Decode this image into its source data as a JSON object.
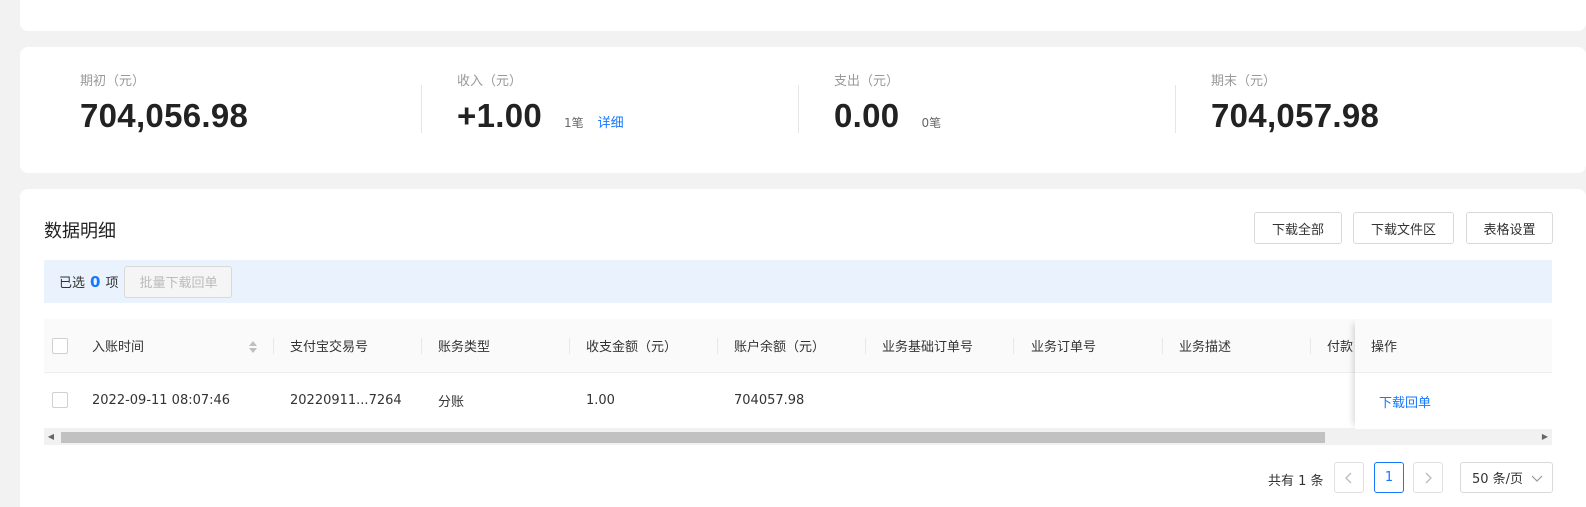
{
  "summary": {
    "opening": {
      "label": "期初（元）",
      "value": "704,056.98"
    },
    "income": {
      "label": "收入（元）",
      "value": "+1.00",
      "count": "1笔",
      "link": "详细"
    },
    "expense": {
      "label": "支出（元）",
      "value": "0.00",
      "count": "0笔"
    },
    "closing": {
      "label": "期末（元）",
      "value": "704,057.98"
    }
  },
  "detail": {
    "title": "数据明细",
    "buttons": {
      "download_all": "下载全部",
      "download_area": "下载文件区",
      "table_settings": "表格设置"
    },
    "selection": {
      "prefix": "已选",
      "count": "0",
      "suffix": "项",
      "batch_button": "批量下载回单"
    }
  },
  "table": {
    "columns": [
      "入账时间",
      "支付宝交易号",
      "账务类型",
      "收支金额（元）",
      "账户余额（元）",
      "业务基础订单号",
      "业务订单号",
      "业务描述",
      "付款"
    ],
    "action_header": "操作",
    "rows": [
      {
        "time": "2022-09-11 08:07:46",
        "trade_no": "20220911...7264",
        "type": "分账",
        "amount": "1.00",
        "balance": "704057.98",
        "action": "下载回单"
      }
    ]
  },
  "pagination": {
    "total": "共有 1 条",
    "current_page": "1",
    "page_size": "50 条/页"
  }
}
